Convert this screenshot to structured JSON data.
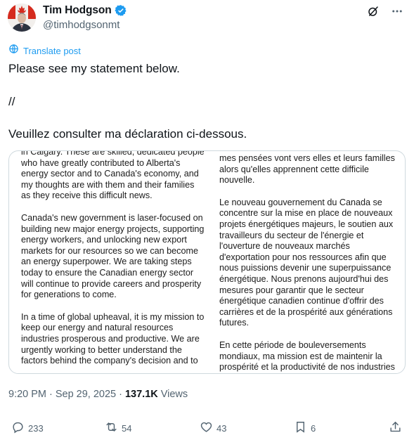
{
  "author": {
    "display_name": "Tim Hodgson",
    "handle": "@timhodgsonmt"
  },
  "translate_label": "Translate post",
  "tweet_lines": [
    "Please see my statement below.",
    "//",
    "Veuillez consulter ma déclaration ci-dessous."
  ],
  "statement": {
    "left_column": [
      "in Calgary. These are skilled, dedicated people who have greatly contributed to Alberta's energy sector and to Canada's economy, and my thoughts are with them and their families as they receive this difficult news.",
      "Canada's new government is laser-focused on building new major energy projects, supporting energy workers, and unlocking new export markets for our resources so we can become an energy superpower. We are taking steps today to ensure the Canadian energy sector will continue to provide careers and prosperity for generations to come.",
      "In a time of global upheaval, it is my mission to keep our energy and natural resources industries prosperous and productive. We are urgently working to better understand the factors behind the company's decision and to"
    ],
    "right_column": [
      "mes pensées vont vers elles et leurs familles alors qu'elles apprennent cette difficile nouvelle.",
      "Le nouveau gouvernement du Canada se concentre sur la mise en place de nouveaux projets énergétiques majeurs, le soutien aux travailleurs du secteur de l'énergie et l'ouverture de nouveaux marchés d'exportation pour nos ressources afin que nous puissions devenir une superpuissance énergétique. Nous prenons aujourd'hui des mesures pour garantir que le secteur énergétique canadien continue d'offrir des carrières et de la prospérité aux générations futures.",
      "En cette période de bouleversements mondiaux, ma mission est de maintenir la prospérité et la productivité de nos industries"
    ]
  },
  "meta": {
    "time": "9:20 PM",
    "separator": "·",
    "date": "Sep 29, 2025",
    "views_count": "137.1K",
    "views_label": "Views"
  },
  "actions": {
    "replies": "233",
    "reposts": "54",
    "likes": "43",
    "bookmarks": "6"
  },
  "icons": {
    "verified": "verified-badge-icon",
    "grok": "grok-icon",
    "more": "more-icon",
    "translate": "translate-icon",
    "reply": "reply-icon",
    "repost": "repost-icon",
    "like": "like-icon",
    "bookmark": "bookmark-icon",
    "share": "share-icon"
  },
  "colors": {
    "accent": "#1d9bf0",
    "text": "#0f1419",
    "secondary": "#536471"
  }
}
